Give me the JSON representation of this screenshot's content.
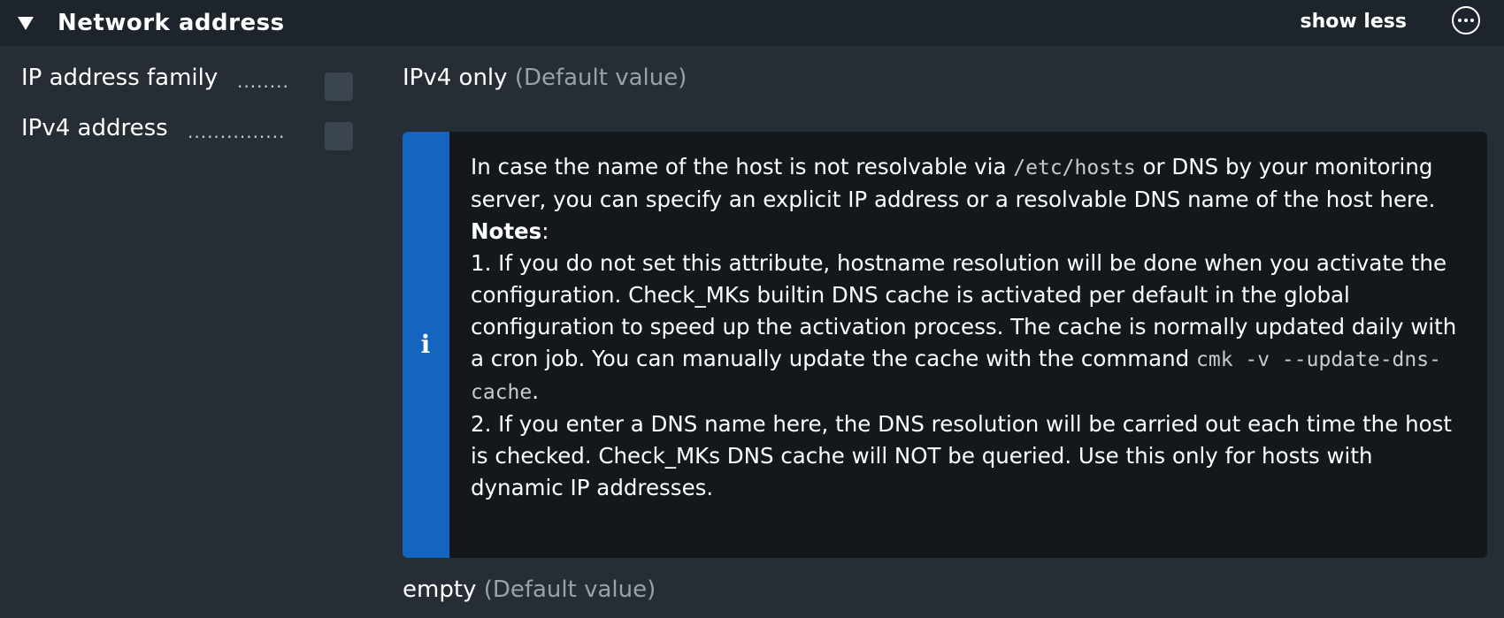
{
  "header": {
    "title": "Network address",
    "show_less_label": "show less"
  },
  "rows": [
    {
      "label": "IP address family",
      "dots": "........",
      "value": "IPv4 only",
      "default_note": "(Default value)"
    },
    {
      "label": "IPv4 address",
      "dots": "...............",
      "value": "empty",
      "default_note": "(Default value)"
    }
  ],
  "help": {
    "intro_1": "In case the name of the host is not resolvable via",
    "intro_code": "/etc/hosts",
    "intro_2": "or DNS by your monitoring server, you can specify an explicit IP address or a resolvable DNS name of the host here.",
    "notes_label": "Notes",
    "notes_colon": ":",
    "note1_text": "1. If you do not set this attribute, hostname resolution will be done when you activate the configuration. Check_MKs builtin DNS cache is activated per default in the global configuration to speed up the activation process. The cache is normally updated daily with a cron job. You can manually update the cache with the command",
    "note1_code": "cmk -v --update-dns-cache",
    "note1_end": ".",
    "note2_text": "2. If you enter a DNS name here, the DNS resolution will be carried out each time the host is checked. Check_MKs DNS cache will NOT be queried. Use this only for hosts with dynamic IP addresses.",
    "icon": "i"
  },
  "colors": {
    "background": "#262d35",
    "header_bg": "#1e242b",
    "info_accent": "#1565c0",
    "info_bg": "#13181d",
    "checkbox": "#3b4551",
    "default_text": "#9aa1a8"
  },
  "icons": {
    "toggle": "triangle-down-icon",
    "more": "ellipsis-circle-icon",
    "info": "info-icon"
  }
}
